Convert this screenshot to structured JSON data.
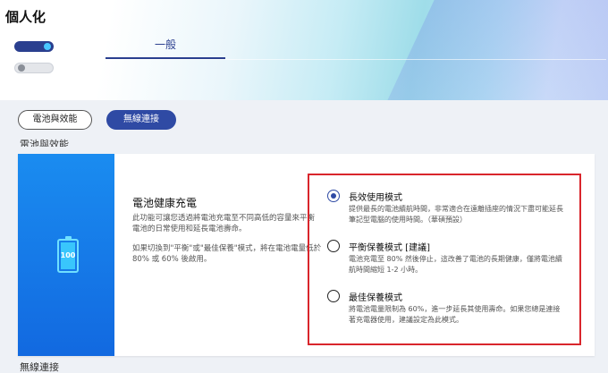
{
  "app": {
    "title": "個人化"
  },
  "tabs": [
    {
      "label": "一般"
    }
  ],
  "pills": {
    "battery": "電池與效能",
    "wireless": "無線連接"
  },
  "section_label": "電池與效能",
  "section_label_bottom": "無線連接",
  "feature": {
    "title": "電池健康充電",
    "description": "此功能可讓您透過將電池充電至不同高低的容量來平衡電池的日常使用和延長電池壽命。",
    "note": "如果切換到\"平衡\"或\"最佳保養\"模式，將在電池電量低於 80% 或 60% 後啟用。",
    "battery_level": "100"
  },
  "options": [
    {
      "title": "長效使用模式",
      "description": "提供最長的電池續航時間，非常適合在遠離插座的情況下盡可能延長筆記型電腦的使用時間。（華碩預設）",
      "checked": true
    },
    {
      "title": "平衡保養模式 [建議]",
      "description": "電池充電至 80% 然後停止，這改善了電池的長期健康，僅將電池續航時間縮短 1-2 小時。",
      "checked": false
    },
    {
      "title": "最佳保養模式",
      "description": "將電池電量限制為 60%，進一步延長其使用壽命。如果您總是連接著充電器使用，建議設定為此模式。",
      "checked": false
    }
  ],
  "colors": {
    "accent": "#2f4aa4",
    "highlight": "#d9262c",
    "side_panel": "#1269e0"
  }
}
